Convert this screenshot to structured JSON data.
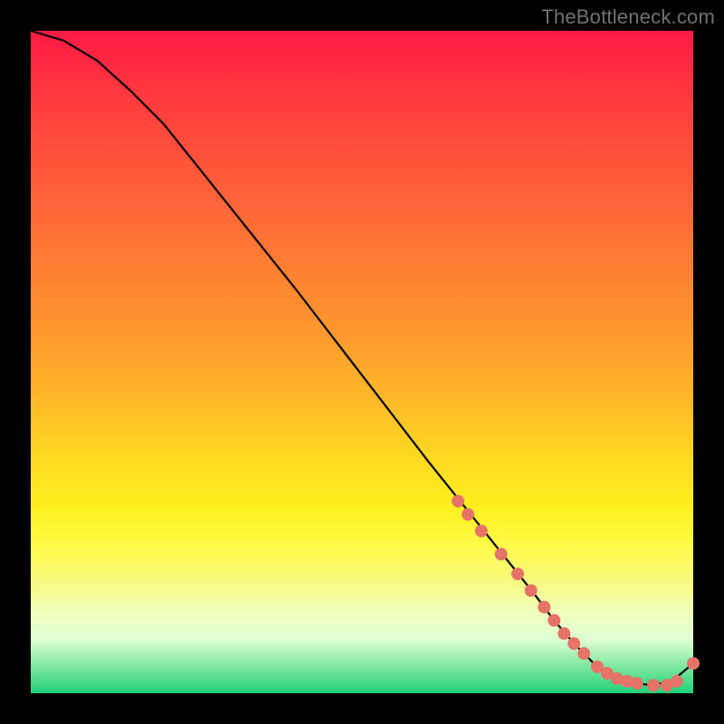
{
  "watermark": "TheBottleneck.com",
  "chart_data": {
    "type": "line",
    "title": "",
    "xlabel": "",
    "ylabel": "",
    "xlim": [
      0,
      1
    ],
    "ylim": [
      0,
      1
    ],
    "series": [
      {
        "name": "bottleneck-curve",
        "color": "#000000",
        "x": [
          0.0,
          0.05,
          0.1,
          0.15,
          0.2,
          0.3,
          0.4,
          0.5,
          0.6,
          0.68,
          0.72,
          0.76,
          0.79,
          0.82,
          0.85,
          0.88,
          0.91,
          0.94,
          0.97,
          1.0
        ],
        "y": [
          1.0,
          0.985,
          0.955,
          0.91,
          0.86,
          0.735,
          0.61,
          0.48,
          0.35,
          0.25,
          0.2,
          0.15,
          0.11,
          0.075,
          0.045,
          0.025,
          0.015,
          0.012,
          0.02,
          0.045
        ]
      }
    ],
    "markers": {
      "name": "highlighted-points",
      "color": "#e57368",
      "radius": 7,
      "x": [
        0.645,
        0.66,
        0.68,
        0.71,
        0.735,
        0.755,
        0.775,
        0.79,
        0.805,
        0.82,
        0.835,
        0.855,
        0.87,
        0.885,
        0.9,
        0.915,
        0.94,
        0.96,
        0.975,
        1.0
      ],
      "y": [
        0.29,
        0.27,
        0.245,
        0.21,
        0.18,
        0.155,
        0.13,
        0.11,
        0.09,
        0.075,
        0.06,
        0.04,
        0.03,
        0.022,
        0.018,
        0.015,
        0.012,
        0.012,
        0.018,
        0.045
      ]
    }
  }
}
